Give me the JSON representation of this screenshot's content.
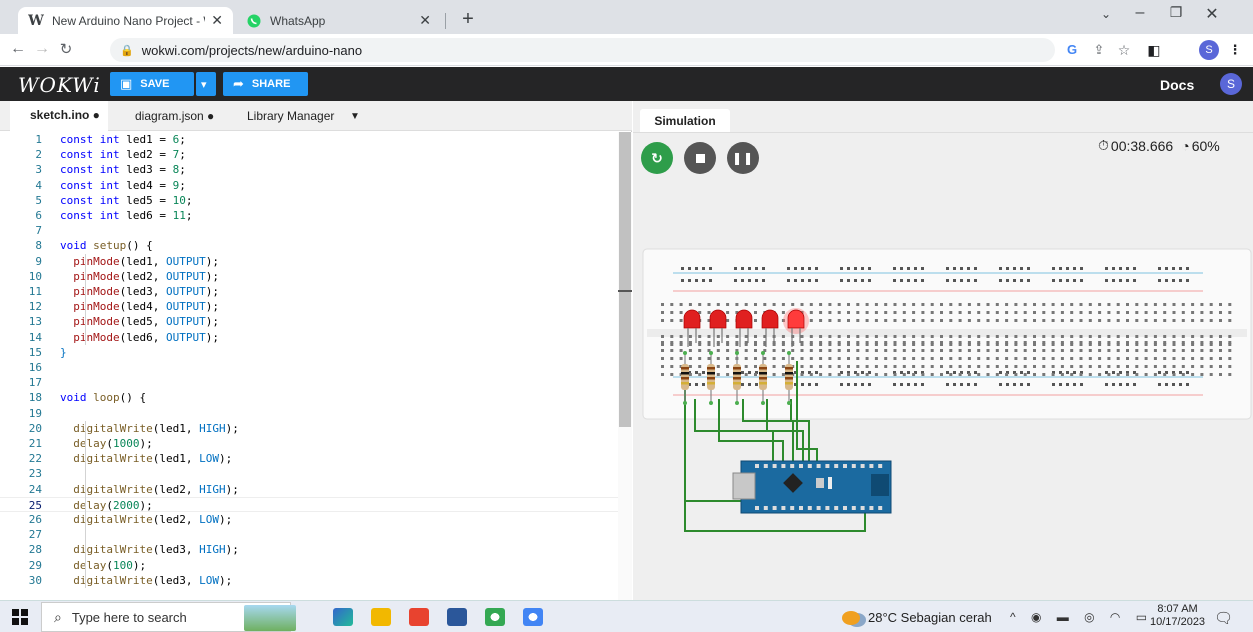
{
  "browser": {
    "tabs": [
      {
        "title": "New Arduino Nano Project - Wc",
        "favicon": "W",
        "active": true
      },
      {
        "title": "WhatsApp",
        "favicon": "whatsapp-icon",
        "active": false
      }
    ],
    "url": "wokwi.com/projects/new/arduino-nano",
    "profile_initial": "S"
  },
  "wokwi": {
    "logo": "WOKWi",
    "save_label": "SAVE",
    "share_label": "SHARE",
    "docs_label": "Docs",
    "avatar_initial": "S"
  },
  "editor": {
    "tabs": [
      "sketch.ino ●",
      "diagram.json ●",
      "Library Manager"
    ],
    "current_line": 25,
    "lines": [
      [
        [
          "kw",
          "const "
        ],
        [
          "kw",
          "int "
        ],
        [
          "txt",
          "led1 = "
        ],
        [
          "num",
          "6"
        ],
        [
          "txt",
          ";"
        ]
      ],
      [
        [
          "kw",
          "const "
        ],
        [
          "kw",
          "int "
        ],
        [
          "txt",
          "led2 = "
        ],
        [
          "num",
          "7"
        ],
        [
          "txt",
          ";"
        ]
      ],
      [
        [
          "kw",
          "const "
        ],
        [
          "kw",
          "int "
        ],
        [
          "txt",
          "led3 = "
        ],
        [
          "num",
          "8"
        ],
        [
          "txt",
          ";"
        ]
      ],
      [
        [
          "kw",
          "const "
        ],
        [
          "kw",
          "int "
        ],
        [
          "txt",
          "led4 = "
        ],
        [
          "num",
          "9"
        ],
        [
          "txt",
          ";"
        ]
      ],
      [
        [
          "kw",
          "const "
        ],
        [
          "kw",
          "int "
        ],
        [
          "txt",
          "led5 = "
        ],
        [
          "num",
          "10"
        ],
        [
          "txt",
          ";"
        ]
      ],
      [
        [
          "kw",
          "const "
        ],
        [
          "kw",
          "int "
        ],
        [
          "txt",
          "led6 = "
        ],
        [
          "num",
          "11"
        ],
        [
          "txt",
          ";"
        ]
      ],
      [],
      [
        [
          "kw",
          "void "
        ],
        [
          "fn",
          "setup"
        ],
        [
          "txt",
          "() {"
        ]
      ],
      [
        [
          "txt",
          "  "
        ],
        [
          "fnr",
          "pinMode"
        ],
        [
          "txt",
          "(led1, "
        ],
        [
          "cst",
          "OUTPUT"
        ],
        [
          "txt",
          ");"
        ]
      ],
      [
        [
          "txt",
          "  "
        ],
        [
          "fnr",
          "pinMode"
        ],
        [
          "txt",
          "(led2, "
        ],
        [
          "cst",
          "OUTPUT"
        ],
        [
          "txt",
          ");"
        ]
      ],
      [
        [
          "txt",
          "  "
        ],
        [
          "fnr",
          "pinMode"
        ],
        [
          "txt",
          "(led3, "
        ],
        [
          "cst",
          "OUTPUT"
        ],
        [
          "txt",
          ");"
        ]
      ],
      [
        [
          "txt",
          "  "
        ],
        [
          "fnr",
          "pinMode"
        ],
        [
          "txt",
          "(led4, "
        ],
        [
          "cst",
          "OUTPUT"
        ],
        [
          "txt",
          ");"
        ]
      ],
      [
        [
          "txt",
          "  "
        ],
        [
          "fnr",
          "pinMode"
        ],
        [
          "txt",
          "(led5, "
        ],
        [
          "cst",
          "OUTPUT"
        ],
        [
          "txt",
          ");"
        ]
      ],
      [
        [
          "txt",
          "  "
        ],
        [
          "fnr",
          "pinMode"
        ],
        [
          "txt",
          "(led6, "
        ],
        [
          "cst",
          "OUTPUT"
        ],
        [
          "txt",
          ");"
        ]
      ],
      [
        [
          "cst",
          "}"
        ]
      ],
      [],
      [],
      [
        [
          "kw",
          "void "
        ],
        [
          "fn",
          "loop"
        ],
        [
          "txt",
          "() {"
        ]
      ],
      [],
      [
        [
          "txt",
          "  "
        ],
        [
          "fn",
          "digitalWrite"
        ],
        [
          "txt",
          "(led1, "
        ],
        [
          "cst",
          "HIGH"
        ],
        [
          "txt",
          ");"
        ]
      ],
      [
        [
          "txt",
          "  "
        ],
        [
          "fn",
          "delay"
        ],
        [
          "txt",
          "("
        ],
        [
          "num",
          "1000"
        ],
        [
          "txt",
          ");"
        ]
      ],
      [
        [
          "txt",
          "  "
        ],
        [
          "fn",
          "digitalWrite"
        ],
        [
          "txt",
          "(led1, "
        ],
        [
          "cst",
          "LOW"
        ],
        [
          "txt",
          ");"
        ]
      ],
      [],
      [
        [
          "txt",
          "  "
        ],
        [
          "fn",
          "digitalWrite"
        ],
        [
          "txt",
          "(led2, "
        ],
        [
          "cst",
          "HIGH"
        ],
        [
          "txt",
          ");"
        ]
      ],
      [
        [
          "txt",
          "  "
        ],
        [
          "fn",
          "delay"
        ],
        [
          "txt",
          "("
        ],
        [
          "num",
          "2000"
        ],
        [
          "txt",
          ");"
        ]
      ],
      [
        [
          "txt",
          "  "
        ],
        [
          "fn",
          "digitalWrite"
        ],
        [
          "txt",
          "(led2, "
        ],
        [
          "cst",
          "LOW"
        ],
        [
          "txt",
          ");"
        ]
      ],
      [],
      [
        [
          "txt",
          "  "
        ],
        [
          "fn",
          "digitalWrite"
        ],
        [
          "txt",
          "(led3, "
        ],
        [
          "cst",
          "HIGH"
        ],
        [
          "txt",
          ");"
        ]
      ],
      [
        [
          "txt",
          "  "
        ],
        [
          "fn",
          "delay"
        ],
        [
          "txt",
          "("
        ],
        [
          "num",
          "100"
        ],
        [
          "txt",
          ");"
        ]
      ],
      [
        [
          "txt",
          "  "
        ],
        [
          "fn",
          "digitalWrite"
        ],
        [
          "txt",
          "(led3, "
        ],
        [
          "cst",
          "LOW"
        ],
        [
          "txt",
          ");"
        ]
      ]
    ]
  },
  "simulation": {
    "tab_label": "Simulation",
    "timer": "00:38.666",
    "speed": "60%",
    "leds_lit": [
      false,
      false,
      false,
      false,
      true
    ]
  },
  "taskbar": {
    "search_placeholder": "Type here to search",
    "weather": "28°C  Sebagian cerah",
    "time": "8:07 AM",
    "date": "10/17/2023"
  }
}
